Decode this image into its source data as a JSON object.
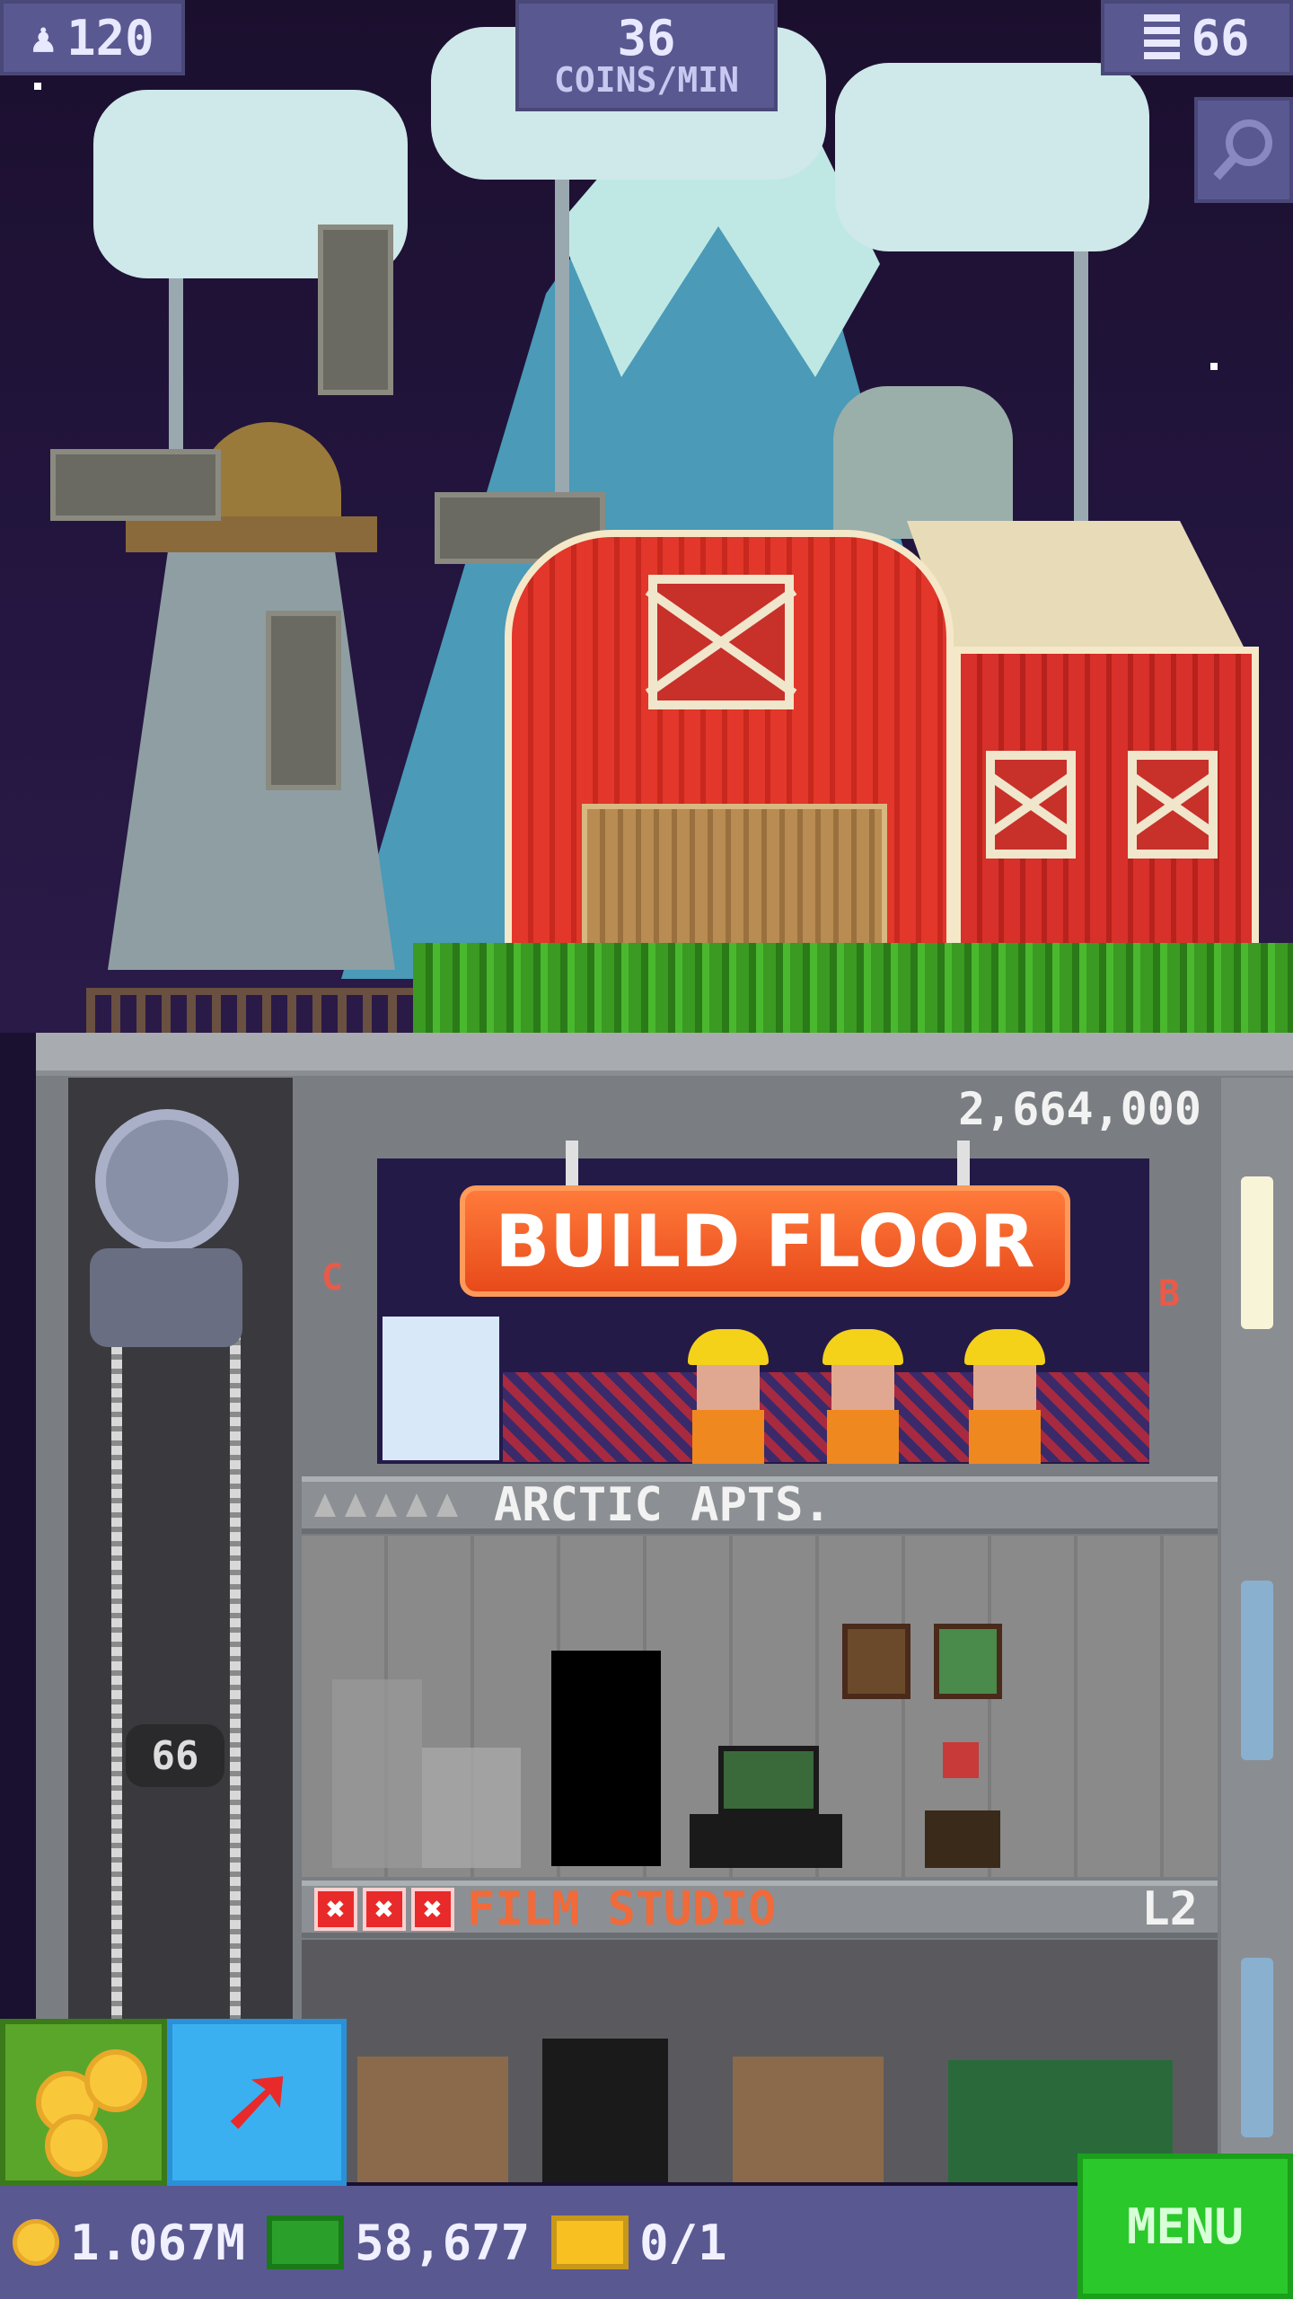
{
  "hud": {
    "population": "120",
    "coins_per_min_value": "36",
    "coins_per_min_label": "COINS/MIN",
    "floors": "66"
  },
  "icons": {
    "population": "person-icon",
    "floors": "building-icon",
    "search": "magnifier-icon",
    "coin": "coin-icon",
    "bux": "tower-bux-icon",
    "ticket": "golden-ticket-icon",
    "build": "arrow-icon"
  },
  "construction": {
    "cost": "2,664,000",
    "sign_label": "BUILD FLOOR",
    "left_letter": "C",
    "right_letter": "B"
  },
  "floors": [
    {
      "name": "ARCTIC APTS.",
      "level": ""
    },
    {
      "name": "FILM STUDIO",
      "level": "L2"
    }
  ],
  "elevator": {
    "floor_number": "66"
  },
  "bottom_bar": {
    "coins": "1.067M",
    "bux": "58,677",
    "tickets": "0/1",
    "menu_label": "MENU"
  },
  "colors": {
    "hud": "#5a5890",
    "build_sign": "#e84a1a",
    "menu": "#2ac82a",
    "film_studio_label": "#f06a3a"
  }
}
